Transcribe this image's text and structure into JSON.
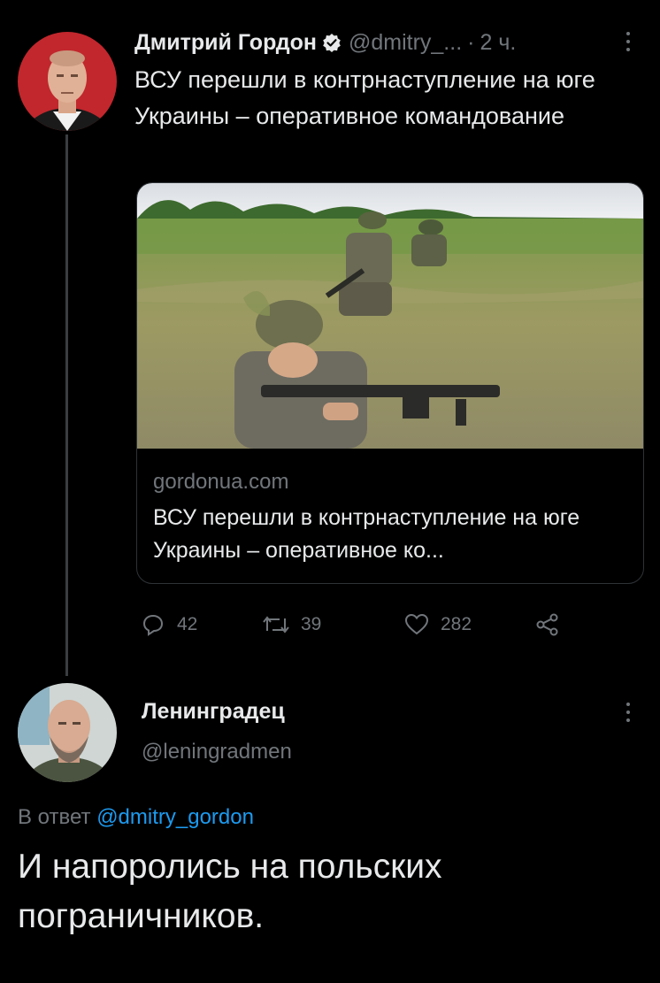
{
  "tweet": {
    "author_name": "Дмитрий Гордон",
    "handle": "@dmitry_...",
    "dot": "·",
    "time": "2 ч.",
    "text": "ВСУ перешли в контрнаступление на юге Украины – оперативное командование",
    "verified_icon": "verified-badge-icon",
    "card": {
      "domain": "gordonua.com",
      "title": "ВСУ перешли в контрнаступление на юге Украины – оперативное ко..."
    },
    "actions": {
      "replies": "42",
      "retweets": "39",
      "likes": "282"
    }
  },
  "reply": {
    "author_name": "Ленинградец",
    "handle": "@leningradmen",
    "reply_prefix": "В ответ",
    "reply_mention": "@dmitry_gordon",
    "text": "И напоролись на польских пограничников."
  },
  "colors": {
    "background": "#000000",
    "text": "#e7e9ea",
    "secondary": "#71767b",
    "accent": "#1d9bf0"
  }
}
